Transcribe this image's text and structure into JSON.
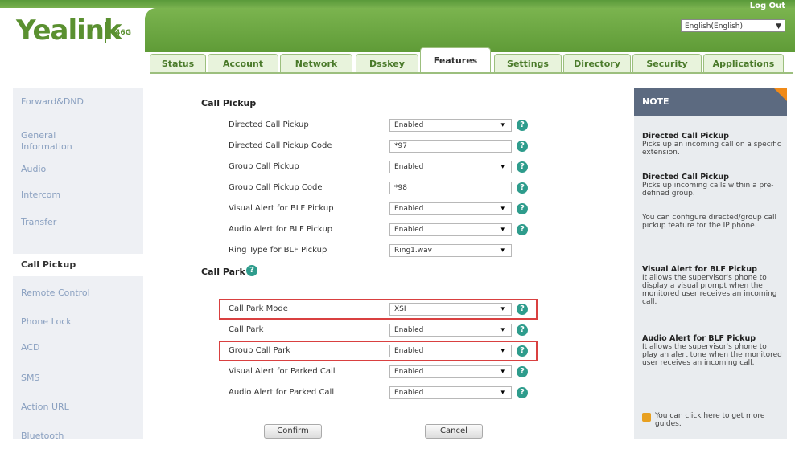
{
  "header": {
    "logo_text": "Yealink",
    "model": "T46G",
    "logout": "Log Out",
    "language": "English(English)",
    "lang_arrow": "▼",
    "green": "#5f9b37"
  },
  "tabs": [
    "Status",
    "Account",
    "Network",
    "Dsskey",
    "Features",
    "Settings",
    "Directory",
    "Security",
    "Applications"
  ],
  "active_tab": "Features",
  "sidebar": {
    "items": [
      "Forward&DND",
      "General Information",
      "Audio",
      "Intercom",
      "Transfer",
      "Call Pickup",
      "Remote Control",
      "Phone Lock",
      "ACD",
      "SMS",
      "Action URL",
      "Bluetooth"
    ],
    "active": "Call Pickup"
  },
  "pickup": {
    "section_title": "Call Pickup",
    "rows": [
      {
        "label": "Directed Call Pickup",
        "value": "Enabled",
        "type": "select"
      },
      {
        "label": "Directed Call Pickup Code",
        "value": "*97",
        "type": "text"
      },
      {
        "label": "Group Call Pickup",
        "value": "Enabled",
        "type": "select"
      },
      {
        "label": "Group Call Pickup Code",
        "value": "*98",
        "type": "text"
      },
      {
        "label": "Visual Alert for BLF Pickup",
        "value": "Enabled",
        "type": "select"
      },
      {
        "label": "Audio Alert for BLF Pickup",
        "value": "Enabled",
        "type": "select"
      },
      {
        "label": "Ring Type for BLF Pickup",
        "value": "Ring1.wav",
        "type": "select"
      }
    ]
  },
  "park": {
    "section_title": "Call Park",
    "rows": [
      {
        "label": "Call Park Mode",
        "value": "XSI",
        "type": "select"
      },
      {
        "label": "Call Park",
        "value": "Enabled",
        "type": "select"
      },
      {
        "label": "Group Call Park",
        "value": "Enabled",
        "type": "select"
      },
      {
        "label": "Visual Alert for Parked Call",
        "value": "Enabled",
        "type": "select"
      },
      {
        "label": "Audio Alert for Parked Call",
        "value": "Enabled",
        "type": "select"
      }
    ]
  },
  "buttons": {
    "confirm": "Confirm",
    "cancel": "Cancel"
  },
  "help_glyph": "?",
  "dropdown_glyph": "▾",
  "note": {
    "title": "NOTE",
    "blocks": [
      {
        "title": "Directed Call Pickup",
        "text": "Picks up an incoming call on a specific extension."
      },
      {
        "title": "Directed Call Pickup",
        "text": "Picks up incoming calls within a pre-defined group."
      },
      {
        "title": "",
        "text": "You can configure directed/group call pickup feature for the IP phone."
      },
      {
        "title": "Visual Alert for BLF Pickup",
        "text": "It allows the supervisor's phone to display a visual prompt when the monitored user receives an incoming call."
      },
      {
        "title": "Audio Alert for BLF Pickup",
        "text": "It allows the supervisor's phone to play an alert tone when the monitored user receives an incoming call."
      }
    ],
    "guide": "You can click here to get more guides."
  }
}
